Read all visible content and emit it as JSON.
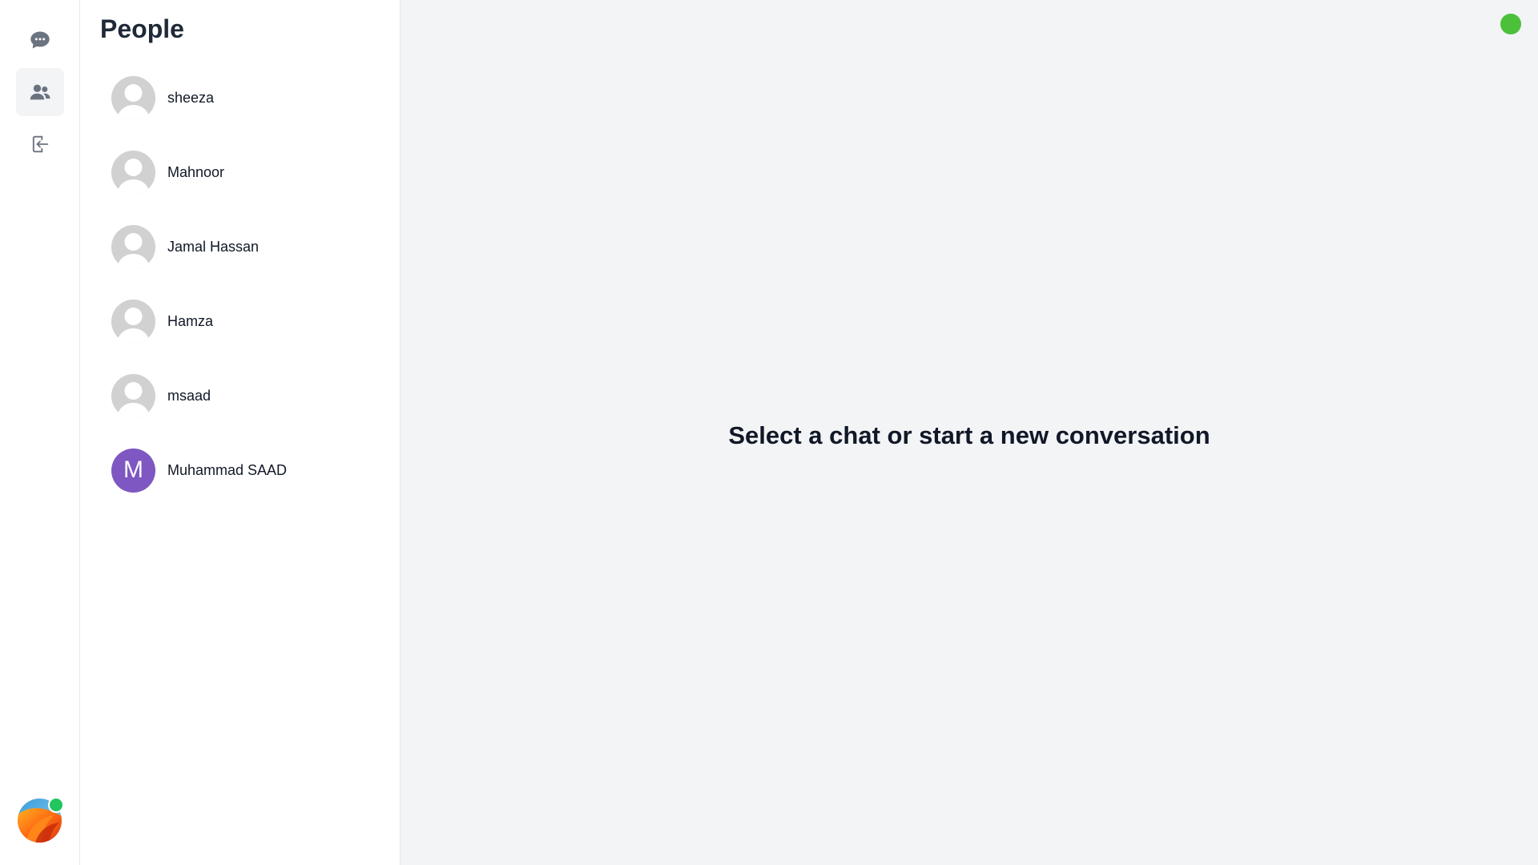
{
  "rail": {
    "items": [
      {
        "icon": "chat-bubble-icon",
        "active": false
      },
      {
        "icon": "users-icon",
        "active": true
      },
      {
        "icon": "logout-icon",
        "active": false
      }
    ],
    "online_color": "#22c55e"
  },
  "people": {
    "title": "People",
    "list": [
      {
        "name": "sheeza",
        "avatar": "default-user-icon"
      },
      {
        "name": "Mahnoor",
        "avatar": "default-user-icon"
      },
      {
        "name": "Jamal Hassan",
        "avatar": "default-user-icon"
      },
      {
        "name": "Hamza",
        "avatar": "default-user-icon"
      },
      {
        "name": "msaad",
        "avatar": "default-user-icon"
      },
      {
        "name": "Muhammad SAAD",
        "avatar_letter": "M",
        "avatar_color": "#7e57c2"
      }
    ]
  },
  "main": {
    "empty_message": "Select a chat or start a new conversation",
    "status_color": "#4cc03a"
  }
}
